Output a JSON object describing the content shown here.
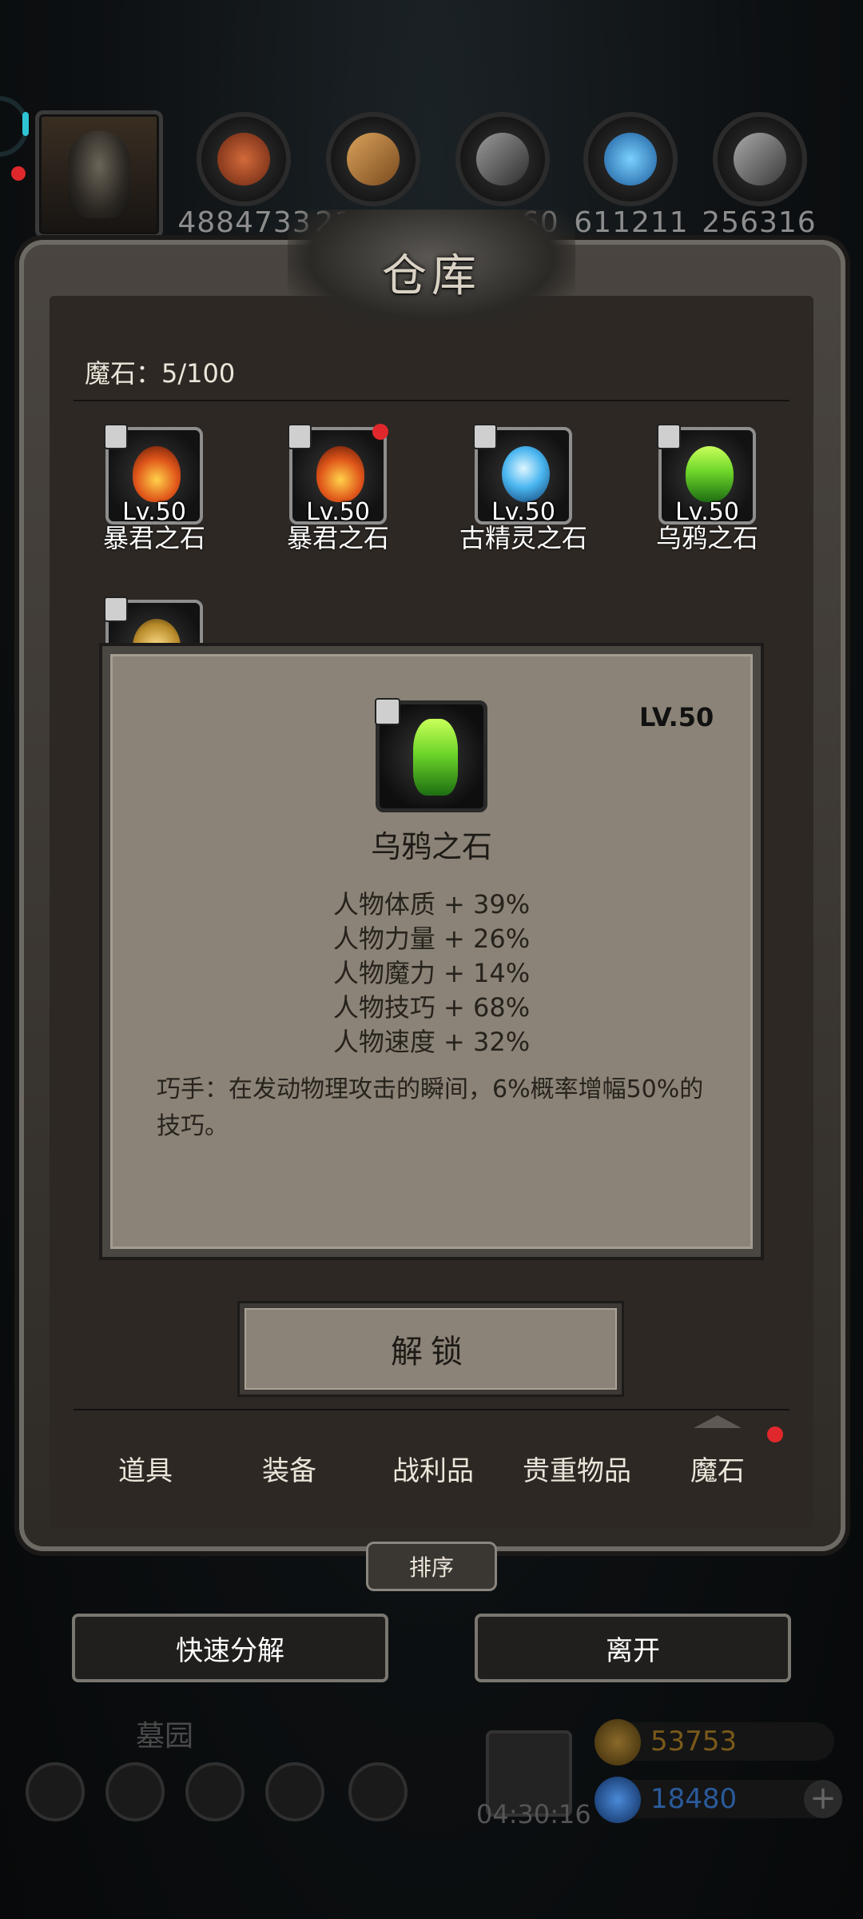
{
  "resources": [
    {
      "icon": "meat-icon",
      "value": "4884733",
      "color": "#b44a2a"
    },
    {
      "icon": "wood-icon",
      "value": "213169",
      "color": "#b97c3e"
    },
    {
      "icon": "iron-icon",
      "value": "251260",
      "color": "#7a7a7a"
    },
    {
      "icon": "crystal-icon",
      "value": "611211",
      "color": "#3aa8e8"
    },
    {
      "icon": "stone-icon",
      "value": "256316",
      "color": "#8a8a8a"
    }
  ],
  "warehouse": {
    "title": "仓库",
    "capacity_label": "魔石：5/100",
    "items": [
      {
        "name": "暴君之石",
        "level": "Lv.50",
        "gem": "fire",
        "new": false
      },
      {
        "name": "暴君之石",
        "level": "Lv.50",
        "gem": "fire",
        "new": true
      },
      {
        "name": "古精灵之石",
        "level": "Lv.50",
        "gem": "ice",
        "new": false
      },
      {
        "name": "乌鸦之石",
        "level": "Lv.50",
        "gem": "green",
        "new": false
      },
      {
        "name": "",
        "level": "",
        "gem": "gold",
        "new": false
      }
    ]
  },
  "detail": {
    "level": "LV.50",
    "name": "乌鸦之石",
    "stats": [
      "人物体质 + 39%",
      "人物力量 + 26%",
      "人物魔力 + 14%",
      "人物技巧 + 68%",
      "人物速度 + 32%"
    ],
    "effect": "巧手：在发动物理攻击的瞬间，6%概率增幅50%的技巧。",
    "unlock_label": "解锁"
  },
  "tabs": [
    {
      "label": "道具",
      "active": false
    },
    {
      "label": "装备",
      "active": false
    },
    {
      "label": "战利品",
      "active": false
    },
    {
      "label": "贵重物品",
      "active": false
    },
    {
      "label": "魔石",
      "active": true
    }
  ],
  "sort_label": "排序",
  "actions": {
    "quick_decompose": "快速分解",
    "leave": "离开"
  },
  "hud": {
    "location": "墓园",
    "timer": "04:30:16",
    "gold": "53753",
    "gems": "18480",
    "gold_color": "#c8a23a",
    "gem_color": "#3a8ad8"
  }
}
